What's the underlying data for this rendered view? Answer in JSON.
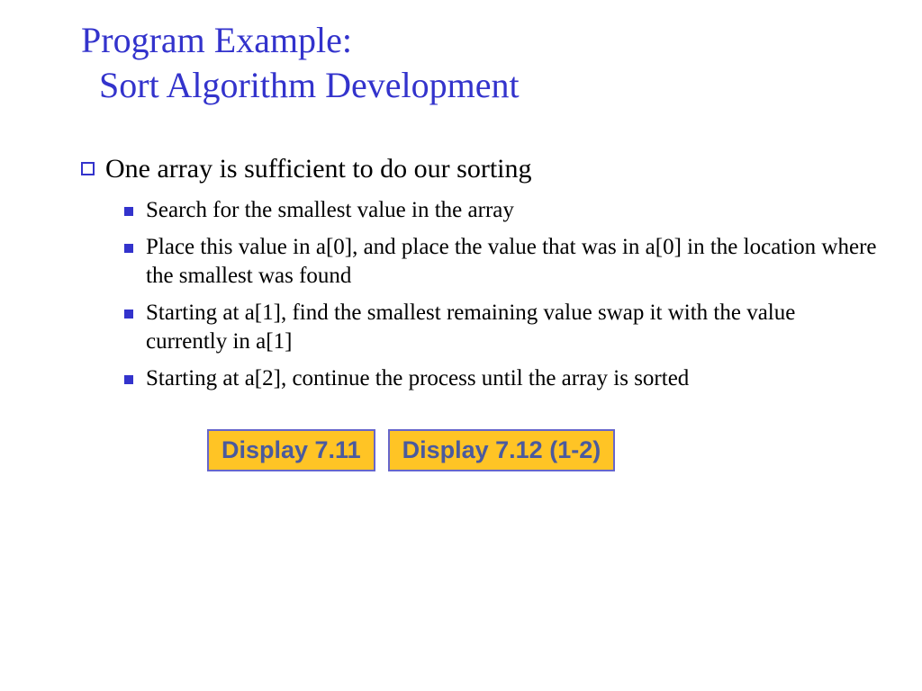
{
  "title": {
    "line1": "Program Example:",
    "line2": "Sort Algorithm Development"
  },
  "main_bullet": "One array is sufficient to do our sorting",
  "sub_bullets": [
    "Search for the smallest value in the array",
    "Place this value in a[0], and place the value that was in a[0] in the location where the smallest was found",
    "Starting at a[1], find the smallest remaining value swap it with the value currently in a[1]",
    "Starting at a[2], continue the process until the array is sorted"
  ],
  "buttons": [
    "Display 7.11",
    "Display 7.12 (1-2)"
  ]
}
